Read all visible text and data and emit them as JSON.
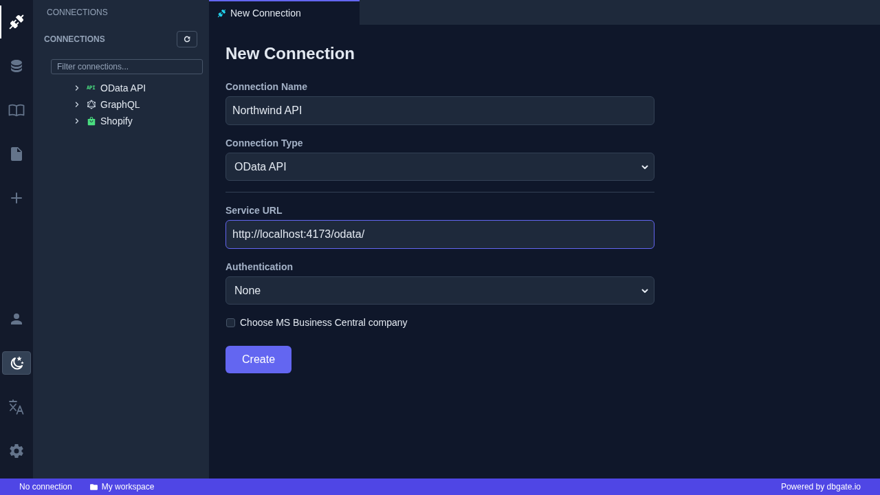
{
  "activity_bar": {
    "top_items": [
      {
        "selected": true
      },
      {
        "selected": false
      },
      {
        "selected": false
      },
      {
        "selected": false
      },
      {
        "selected": false
      }
    ],
    "bottom_items": [
      {
        "highlighted": false
      },
      {
        "highlighted": true
      },
      {
        "highlighted": false
      },
      {
        "highlighted": false
      }
    ]
  },
  "sidebar": {
    "panel_title": "CONNECTIONS",
    "section_title": "CONNECTIONS",
    "filter": {
      "placeholder": "Filter connections..."
    },
    "connections": [
      {
        "kind": "odata",
        "icon_text": "API",
        "label": "OData API",
        "expanded": false
      },
      {
        "kind": "graphql",
        "label": "GraphQL",
        "expanded": false
      },
      {
        "kind": "shopify",
        "label": "Shopify",
        "expanded": false
      }
    ]
  },
  "tabs": [
    {
      "label": "New Connection",
      "selected": true
    }
  ],
  "form": {
    "title": "New Connection",
    "fields": [
      {
        "kind": "text",
        "label": "Connection Name",
        "value": "Northwind API",
        "focused": false
      },
      {
        "kind": "select",
        "label": "Connection Type",
        "value": "OData API"
      },
      {
        "kind": "divider"
      },
      {
        "kind": "text",
        "label": "Service URL",
        "value": "http://localhost:4173/odata/",
        "focused": true
      },
      {
        "kind": "select",
        "label": "Authentication",
        "value": "None"
      },
      {
        "kind": "checkbox",
        "label": "Choose MS Business Central company",
        "checked": false
      }
    ],
    "submit_button": "Create"
  },
  "status_bar": {
    "connection": "No connection",
    "workspace": "My workspace",
    "powered_by": "Powered by dbgate.io"
  }
}
